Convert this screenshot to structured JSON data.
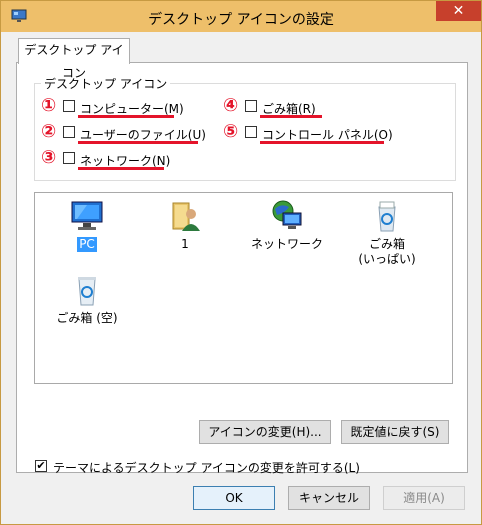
{
  "window": {
    "title": "デスクトップ アイコンの設定",
    "close_label": "✕"
  },
  "tab": {
    "label": "デスクトップ アイコン"
  },
  "group": {
    "title": "デスクトップ アイコン"
  },
  "options": [
    {
      "num": "①",
      "label": "コンピューター(M)",
      "checked": false
    },
    {
      "num": "②",
      "label": "ユーザーのファイル(U)",
      "checked": false
    },
    {
      "num": "③",
      "label": "ネットワーク(N)",
      "checked": false
    },
    {
      "num": "④",
      "label": "ごみ箱(R)",
      "checked": false
    },
    {
      "num": "⑤",
      "label": "コントロール パネル(O)",
      "checked": false
    }
  ],
  "icons": [
    {
      "name": "pc-icon",
      "label": "PC",
      "selected": true
    },
    {
      "name": "user-folder-icon",
      "label": "1",
      "selected": false
    },
    {
      "name": "network-icon",
      "label": "ネットワーク",
      "selected": false
    },
    {
      "name": "recycle-bin-full-icon",
      "label": "ごみ箱\n(いっぱい)",
      "selected": false
    },
    {
      "name": "recycle-bin-empty-icon",
      "label": "ごみ箱 (空)",
      "selected": false
    }
  ],
  "buttons": {
    "change_icon": "アイコンの変更(H)...",
    "restore_default": "既定値に戻す(S)",
    "ok": "OK",
    "cancel": "キャンセル",
    "apply": "適用(A)"
  },
  "theme": {
    "label": "テーマによるデスクトップ アイコンの変更を許可する(L)",
    "checked": true,
    "check_glyph": "✔"
  },
  "colors": {
    "accent_red": "#e4142a",
    "selection_blue": "#3399ff",
    "titlebar": "#eebf6a"
  }
}
